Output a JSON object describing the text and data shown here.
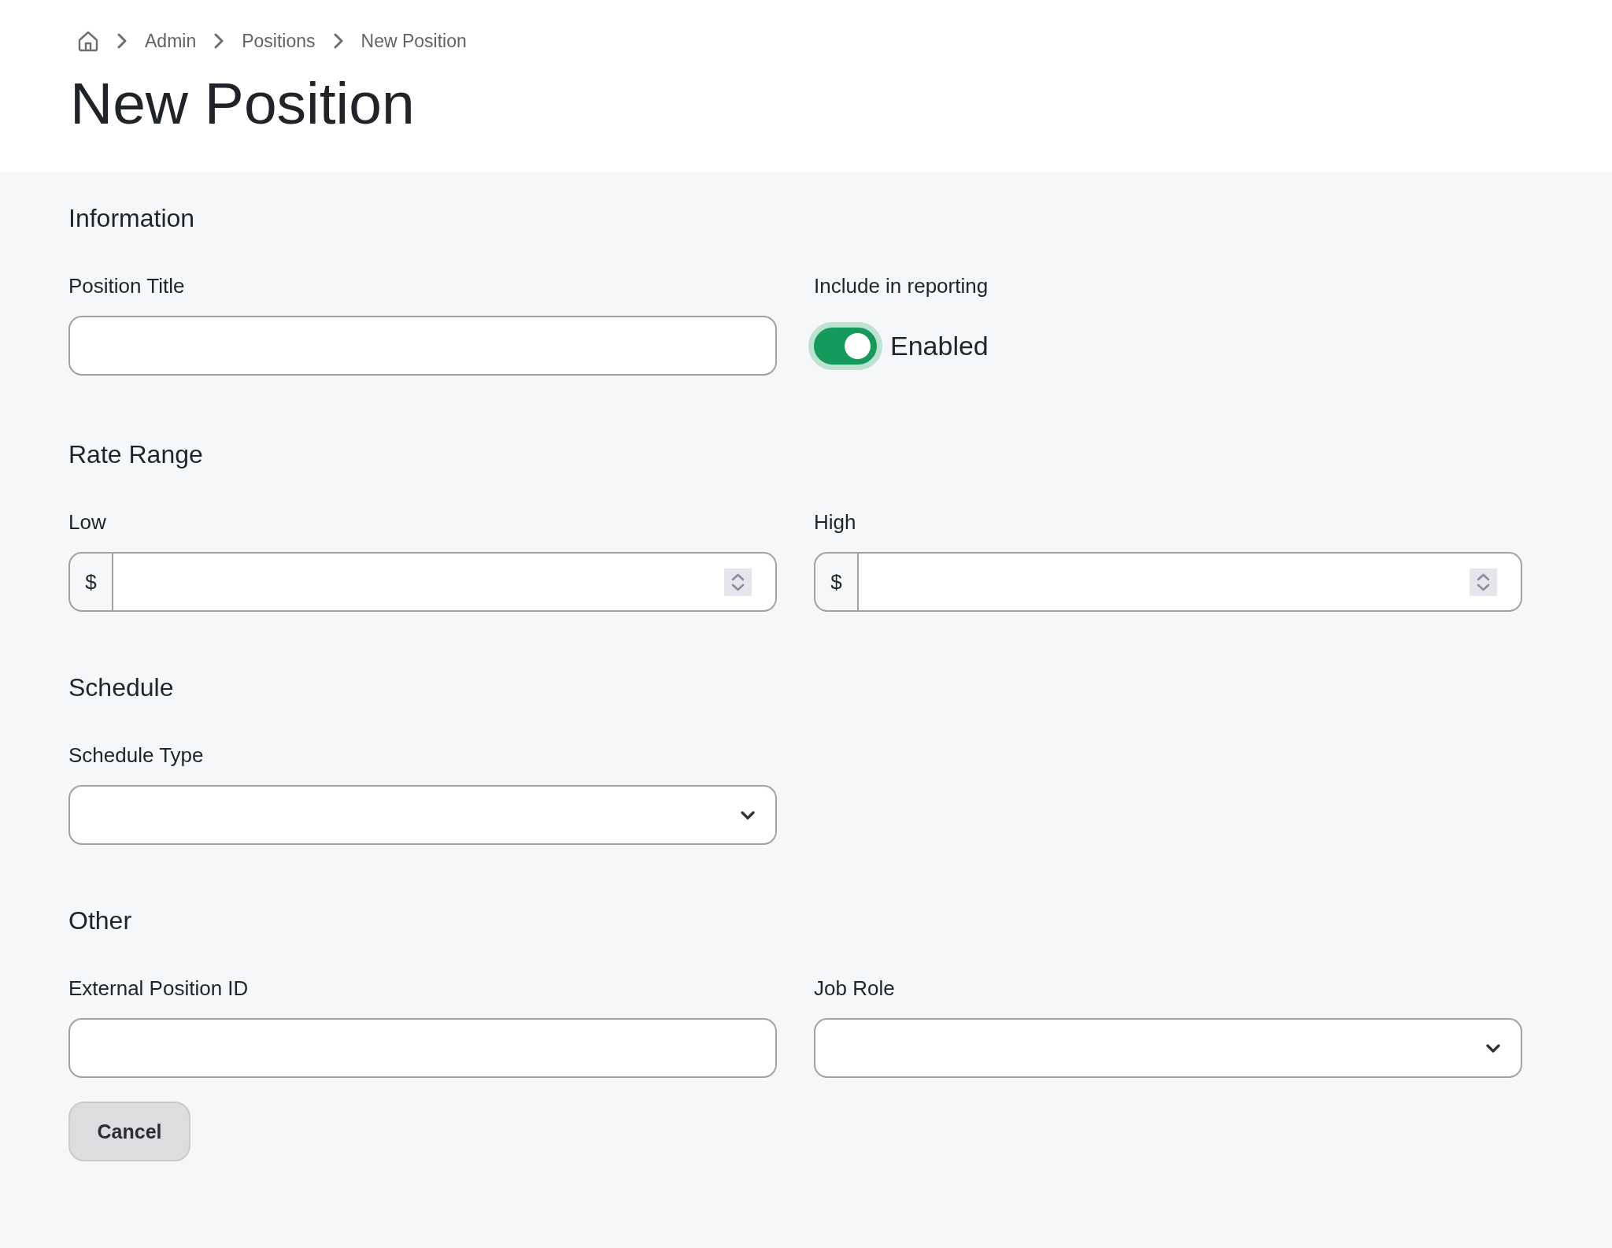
{
  "breadcrumb": {
    "items": [
      {
        "label": "Admin"
      },
      {
        "label": "Positions"
      },
      {
        "label": "New Position"
      }
    ]
  },
  "title": "New Position",
  "sections": [
    {
      "heading": "Information",
      "fields": [
        {
          "kind": "text",
          "label": "Position Title"
        },
        {
          "kind": "toggle",
          "label": "Include in reporting",
          "on": true,
          "state_label": "Enabled"
        }
      ]
    },
    {
      "heading": "Rate Range",
      "fields": [
        {
          "kind": "currency",
          "label": "Low",
          "prefix": "$"
        },
        {
          "kind": "currency",
          "label": "High",
          "prefix": "$"
        }
      ]
    },
    {
      "heading": "Schedule",
      "fields": [
        {
          "kind": "select",
          "label": "Schedule Type"
        }
      ]
    },
    {
      "heading": "Other",
      "fields": [
        {
          "kind": "text",
          "label": "External Position ID"
        },
        {
          "kind": "select",
          "label": "Job Role"
        }
      ]
    }
  ],
  "buttons": [
    {
      "label": "Cancel"
    }
  ]
}
